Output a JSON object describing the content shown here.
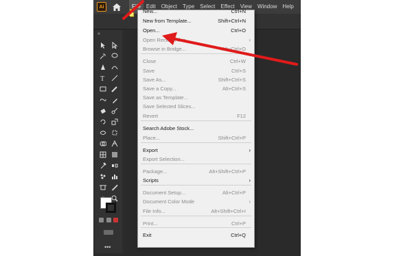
{
  "app": {
    "logo_text": "Ai",
    "menubar": [
      "File",
      "Edit",
      "Object",
      "Type",
      "Select",
      "Effect",
      "View",
      "Window",
      "Help"
    ],
    "accent": "#f29c1f"
  },
  "file_menu": {
    "items": [
      {
        "label": "New...",
        "shortcut": "Ctrl+N",
        "enabled": true
      },
      {
        "label": "New from Template...",
        "shortcut": "Shift+Ctrl+N",
        "enabled": true
      },
      {
        "label": "Open...",
        "shortcut": "Ctrl+O",
        "enabled": true
      },
      {
        "label": "Open Recent Files",
        "shortcut": "",
        "enabled": false
      },
      {
        "label": "Browse in Bridge...",
        "shortcut": "Alt+Ctrl+O",
        "enabled": false
      },
      {
        "label": "Close",
        "shortcut": "Ctrl+W",
        "enabled": false
      },
      {
        "label": "Save",
        "shortcut": "Ctrl+S",
        "enabled": false
      },
      {
        "label": "Save As...",
        "shortcut": "Shift+Ctrl+S",
        "enabled": false
      },
      {
        "label": "Save a Copy...",
        "shortcut": "Alt+Ctrl+S",
        "enabled": false
      },
      {
        "label": "Save as Template...",
        "shortcut": "",
        "enabled": false
      },
      {
        "label": "Save Selected Slices...",
        "shortcut": "",
        "enabled": false
      },
      {
        "label": "Revert",
        "shortcut": "F12",
        "enabled": false
      },
      {
        "label": "Search Adobe Stock...",
        "shortcut": "",
        "enabled": true
      },
      {
        "label": "Place...",
        "shortcut": "Shift+Ctrl+P",
        "enabled": false
      },
      {
        "label": "Export",
        "shortcut": "",
        "enabled": true
      },
      {
        "label": "Export Selection...",
        "shortcut": "",
        "enabled": false
      },
      {
        "label": "Package...",
        "shortcut": "Alt+Shift+Ctrl+P",
        "enabled": false
      },
      {
        "label": "Scripts",
        "shortcut": "",
        "enabled": true
      },
      {
        "label": "Document Setup...",
        "shortcut": "Alt+Ctrl+P",
        "enabled": false
      },
      {
        "label": "Document Color Mode",
        "shortcut": "",
        "enabled": false
      },
      {
        "label": "File Info...",
        "shortcut": "Alt+Shift+Ctrl+I",
        "enabled": false
      },
      {
        "label": "Print...",
        "shortcut": "Ctrl+P",
        "enabled": false
      },
      {
        "label": "Exit",
        "shortcut": "Ctrl+Q",
        "enabled": true
      }
    ]
  },
  "toolbar": {
    "collapse_glyph": "«",
    "more_glyph": "•••",
    "tools": [
      "selection-tool-icon",
      "direct-selection-tool-icon",
      "magic-wand-icon",
      "lasso-icon",
      "pen-tool-icon",
      "curvature-tool-icon",
      "type-tool-icon",
      "line-tool-icon",
      "rectangle-tool-icon",
      "paintbrush-icon",
      "shaper-tool-icon",
      "pencil-icon",
      "eraser-icon",
      "scissors-icon",
      "rotate-tool-icon",
      "scale-tool-icon",
      "width-tool-icon",
      "free-transform-icon",
      "shape-builder-icon",
      "perspective-grid-icon",
      "mesh-tool-icon",
      "gradient-tool-icon",
      "eyedropper-icon",
      "blend-tool-icon",
      "symbol-sprayer-icon",
      "column-graph-icon",
      "artboard-tool-icon",
      "slice-tool-icon",
      "hand-tool-icon",
      "zoom-tool-icon"
    ]
  }
}
